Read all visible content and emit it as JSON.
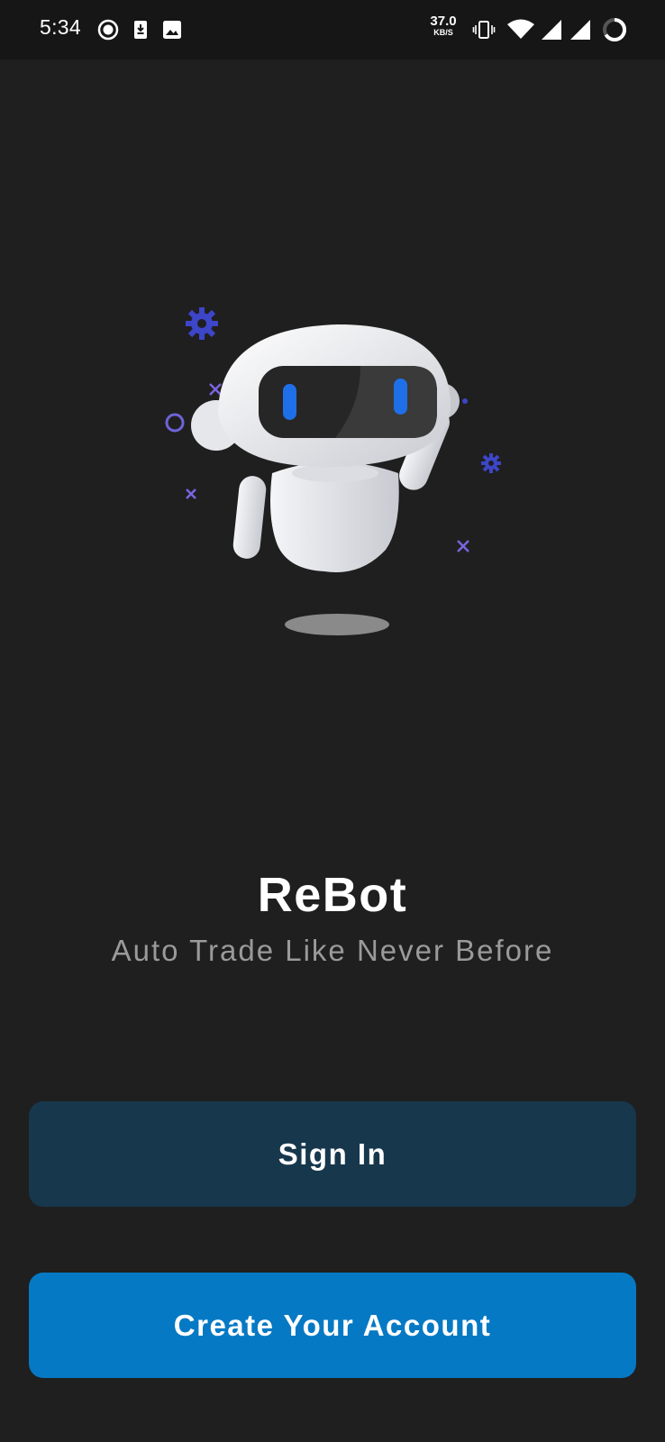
{
  "status_bar": {
    "time": "5:34",
    "net_speed_value": "37.0",
    "net_speed_unit": "KB/S",
    "icons": [
      "record-icon",
      "download-icon",
      "image-icon",
      "vibrate-icon",
      "wifi-icon",
      "signal-icon",
      "signal-icon",
      "battery-icon"
    ]
  },
  "illustration": {
    "icon": "robot-illustration",
    "accent_color": "#3d45c8",
    "eye_color": "#1f6fe8"
  },
  "app": {
    "title": "ReBot",
    "subtitle": "Auto Trade Like Never Before"
  },
  "buttons": {
    "sign_in": "Sign In",
    "create_account": "Create Your Account"
  },
  "colors": {
    "background": "#1f1f1f",
    "status_bar": "#161616",
    "sign_in_button": "#17374d",
    "create_button": "#0679c4",
    "subtitle": "#9a9a9a"
  }
}
